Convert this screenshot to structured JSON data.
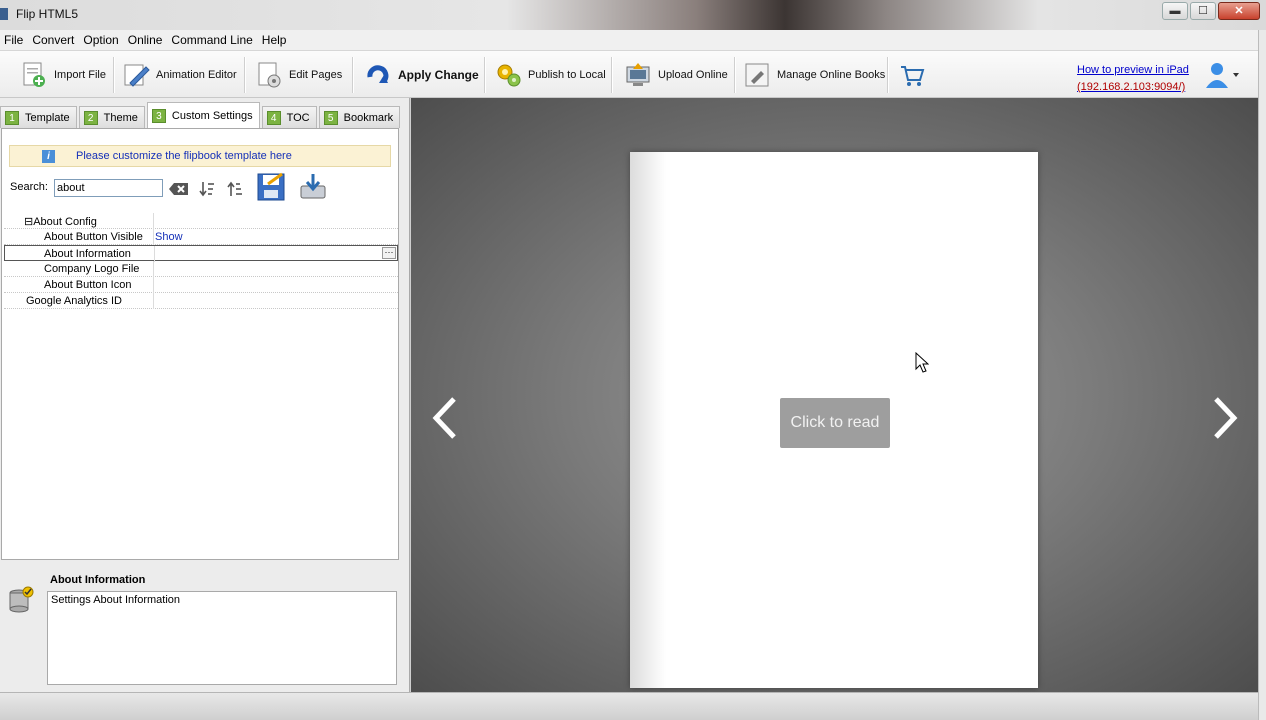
{
  "window": {
    "title": "Flip HTML5",
    "min_label": "▬",
    "max_label": "☐",
    "close_label": "✕"
  },
  "menu": [
    "File",
    "Convert",
    "Option",
    "Online",
    "Command Line",
    "Help"
  ],
  "toolbar": {
    "import_label": "Import File",
    "animation_label": "Animation Editor",
    "edit_label": "Edit Pages",
    "apply_label": "Apply Change",
    "publish_label": "Publish to Local",
    "upload_label": "Upload Online",
    "manage_label": "Manage Online Books",
    "preview_link": "How to preview in iPad",
    "preview_ip": "(192.168.2.103:9094/)"
  },
  "tabs": [
    {
      "num": "1",
      "label": "Template"
    },
    {
      "num": "2",
      "label": "Theme"
    },
    {
      "num": "3",
      "label": "Custom Settings"
    },
    {
      "num": "4",
      "label": "TOC"
    },
    {
      "num": "5",
      "label": "Bookmark"
    }
  ],
  "settings": {
    "hint": "Please customize the flipbook template here",
    "search_label": "Search:",
    "search_value": "about",
    "rows": [
      {
        "key": "⊟About Config",
        "value": ""
      },
      {
        "key": "About Button Visible",
        "value": "Show"
      },
      {
        "key": "About Information",
        "value": "",
        "ellipsis": "···"
      },
      {
        "key": "Company Logo File",
        "value": ""
      },
      {
        "key": "About Button Icon",
        "value": ""
      },
      {
        "key": "Google Analytics ID",
        "value": ""
      }
    ]
  },
  "description": {
    "title": "About Information",
    "text": "Settings About Information"
  },
  "preview": {
    "button_label": "Click to read"
  },
  "colors": {
    "tab_number": "#7cb342",
    "link": "#0000cc",
    "link_ip": "#b00000",
    "value_text": "#1530b8"
  },
  "icons": [
    "import-file-icon",
    "animation-editor-icon",
    "edit-pages-icon",
    "apply-change-icon",
    "publish-icon",
    "upload-icon",
    "manage-books-icon",
    "cart-icon",
    "user-icon",
    "info-icon",
    "clear-search-icon",
    "sort-down-icon",
    "sort-up-icon",
    "save-icon",
    "load-icon",
    "database-icon",
    "prev-page-icon",
    "next-page-icon"
  ]
}
